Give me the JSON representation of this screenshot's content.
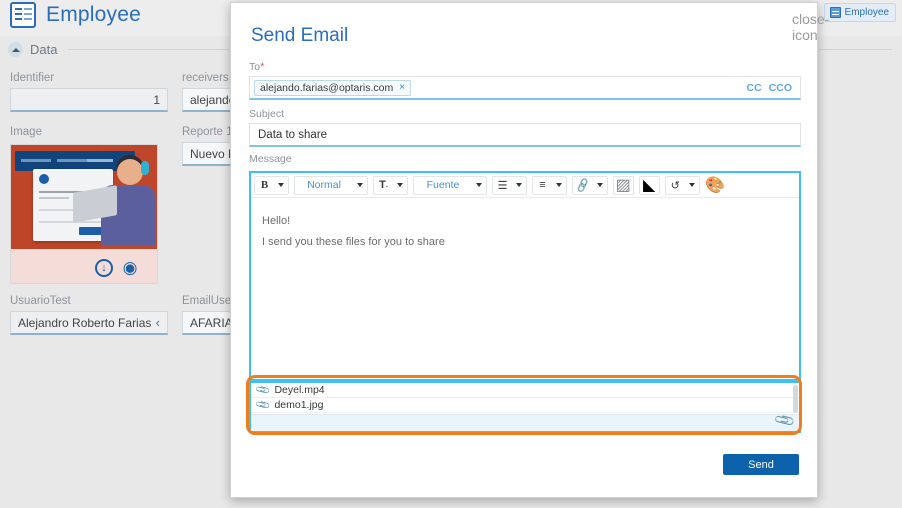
{
  "app": {
    "title": "Employee",
    "title_icon": "clipboard-icon",
    "tab_chip": {
      "label": "Employee",
      "icon": "window-icon"
    },
    "section": {
      "label": "Data",
      "caret": "chevron-up-icon"
    }
  },
  "form": {
    "fields": [
      {
        "name": "identifier",
        "label": "Identifier",
        "value": "1",
        "align": "right"
      },
      {
        "name": "receivers",
        "label": "receivers",
        "value": "alejando.f"
      },
      {
        "name": "image",
        "label": "Image",
        "value": ""
      },
      {
        "name": "reporte1",
        "label": "Reporte 1",
        "value": "Nuevo Do"
      },
      {
        "name": "usuariotest",
        "label": "UsuarioTest",
        "value": "Alejandro Roberto Farias",
        "chevron": "‹"
      },
      {
        "name": "emailuser",
        "label": "EmailUser",
        "value": "AFARIAS."
      }
    ],
    "image_actions": {
      "download_icon": "download-icon",
      "preview_icon": "eye-icon"
    }
  },
  "modal": {
    "title": "Send Email",
    "close_icon": "close-icon",
    "to": {
      "label": "To",
      "required_mark": "*",
      "chip": {
        "text": "alejando.farias@optaris.com",
        "remove_icon": "×"
      },
      "cc_label": "CC",
      "cco_label": "CCO"
    },
    "subject": {
      "label": "Subject",
      "value": "Data to share"
    },
    "message": {
      "label": "Message",
      "lines": [
        "Hello!",
        "I send you these files for you to share"
      ],
      "toolbar": [
        {
          "name": "bold",
          "type": "group",
          "label": "B",
          "caret": true,
          "icon": "bold-icon"
        },
        {
          "name": "heading",
          "type": "group",
          "label": "Normal",
          "caret": true,
          "icon": "heading-select"
        },
        {
          "name": "text-size",
          "type": "group",
          "label": "T",
          "caret": true,
          "icon": "text-size-icon"
        },
        {
          "name": "font",
          "type": "group",
          "label": "Fuente",
          "caret": true,
          "icon": "font-select"
        },
        {
          "name": "list",
          "type": "group",
          "label": "",
          "caret": true,
          "icon": "list-icon"
        },
        {
          "name": "align",
          "type": "group",
          "label": "",
          "caret": true,
          "icon": "align-left-icon"
        },
        {
          "name": "link",
          "type": "group",
          "label": "",
          "caret": true,
          "icon": "link-icon"
        },
        {
          "name": "image",
          "type": "solo",
          "label": "",
          "caret": false,
          "icon": "image-icon"
        },
        {
          "name": "eraser",
          "type": "solo",
          "label": "",
          "caret": false,
          "icon": "eraser-icon"
        },
        {
          "name": "undo",
          "type": "group",
          "label": "",
          "caret": true,
          "icon": "undo-icon"
        },
        {
          "name": "color",
          "type": "plain",
          "label": "",
          "caret": false,
          "icon": "palette-icon"
        }
      ]
    },
    "attachments": {
      "items": [
        {
          "name": "Deyel.mp4",
          "icon": "paperclip-icon"
        },
        {
          "name": "demo1.jpg",
          "icon": "paperclip-icon"
        }
      ],
      "attach_button_icon": "paperclip-icon",
      "highlight_color": "#f07d1b"
    },
    "send_button": "Send"
  },
  "colors": {
    "brand_blue": "#2a6ebb",
    "send_blue": "#0d63ab",
    "focus_cyan": "#3fc0f0",
    "highlight_orange": "#f07d1b",
    "link_blue": "#5fa8dd"
  }
}
